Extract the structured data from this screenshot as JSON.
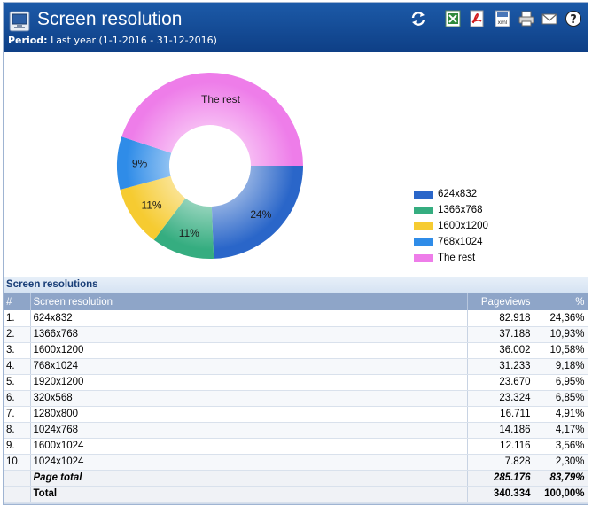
{
  "header": {
    "title": "Screen resolution",
    "period_label": "Period:",
    "period_value": "Last year (1-1-2016 - 31-12-2016)"
  },
  "toolbar": [
    {
      "name": "refresh-icon"
    },
    {
      "name": "excel-export-icon"
    },
    {
      "name": "pdf-export-icon"
    },
    {
      "name": "xml-export-icon"
    },
    {
      "name": "print-icon"
    },
    {
      "name": "email-icon"
    },
    {
      "name": "help-icon"
    }
  ],
  "chart_data": {
    "type": "pie",
    "donut": true,
    "slices": [
      {
        "label": "624x832",
        "value": 24.36,
        "display": "24%",
        "color": "#2a66c9"
      },
      {
        "label": "1366x768",
        "value": 10.93,
        "display": "11%",
        "color": "#35ad80"
      },
      {
        "label": "1600x1200",
        "value": 10.58,
        "display": "11%",
        "color": "#f6cb31"
      },
      {
        "label": "768x1024",
        "value": 9.18,
        "display": "9%",
        "color": "#2f8ce8"
      },
      {
        "label": "The rest",
        "value": 44.95,
        "display": "The rest",
        "color": "#ee7de9"
      }
    ],
    "legend_placement": "right"
  },
  "section": {
    "title": "Screen resolutions"
  },
  "table": {
    "headers": {
      "index": "#",
      "resolution": "Screen resolution",
      "pageviews": "Pageviews",
      "percent": "%"
    },
    "rows": [
      {
        "index": "1.",
        "resolution": "624x832",
        "pageviews": "82.918",
        "percent": "24,36%"
      },
      {
        "index": "2.",
        "resolution": "1366x768",
        "pageviews": "37.188",
        "percent": "10,93%"
      },
      {
        "index": "3.",
        "resolution": "1600x1200",
        "pageviews": "36.002",
        "percent": "10,58%"
      },
      {
        "index": "4.",
        "resolution": "768x1024",
        "pageviews": "31.233",
        "percent": "9,18%"
      },
      {
        "index": "5.",
        "resolution": "1920x1200",
        "pageviews": "23.670",
        "percent": "6,95%"
      },
      {
        "index": "6.",
        "resolution": "320x568",
        "pageviews": "23.324",
        "percent": "6,85%"
      },
      {
        "index": "7.",
        "resolution": "1280x800",
        "pageviews": "16.711",
        "percent": "4,91%"
      },
      {
        "index": "8.",
        "resolution": "1024x768",
        "pageviews": "14.186",
        "percent": "4,17%"
      },
      {
        "index": "9.",
        "resolution": "1600x1024",
        "pageviews": "12.116",
        "percent": "3,56%"
      },
      {
        "index": "10.",
        "resolution": "1024x1024",
        "pageviews": "7.828",
        "percent": "2,30%"
      }
    ],
    "page_total": {
      "label": "Page total",
      "pageviews": "285.176",
      "percent": "83,79%"
    },
    "total": {
      "label": "Total",
      "pageviews": "340.334",
      "percent": "100,00%"
    }
  }
}
